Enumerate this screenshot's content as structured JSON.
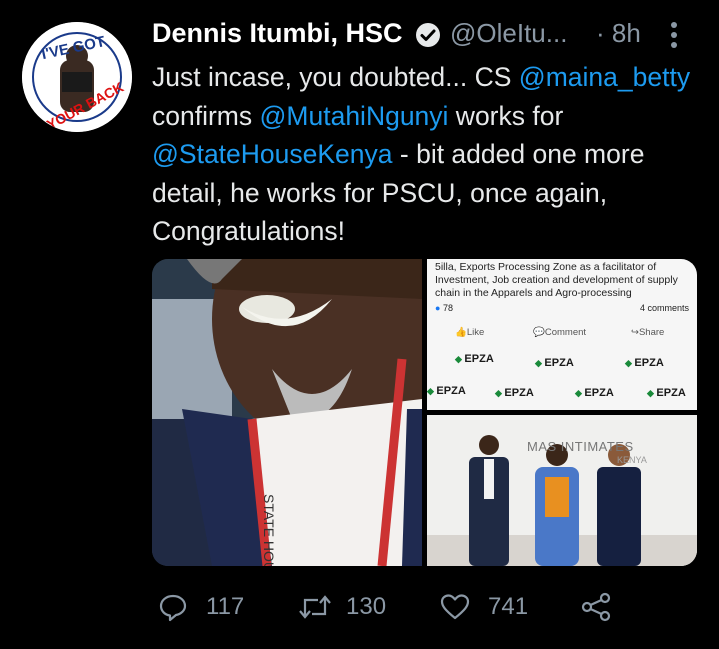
{
  "tweet": {
    "author_name": "Dennis Itumbi, HSC",
    "handle": "@OleItu...",
    "time_sep": "·",
    "time": "8h",
    "avatar_text_top": "I'VE GOT",
    "avatar_text_bottom": "YOUR BACK",
    "text": {
      "p1": "Just incase, you doubted... CS ",
      "m1": "@maina_betty",
      "p2": " confirms ",
      "m2": "@MutahiNgunyi",
      "p3": " works for ",
      "m3": "@StateHouseKenya",
      "p4": " - bit added one more detail, he works for PSCU, once again, Congratulations!"
    }
  },
  "media": {
    "top_right": {
      "text": "5illa, Exports Processing Zone as a facilitator of Investment, Job creation and development of supply chain in the Apparels and Agro-processing",
      "reactions": "78",
      "comments": "4 comments",
      "like": "Like",
      "comment": "Comment",
      "share": "Share",
      "epza": "EPZA"
    },
    "bottom_right": {
      "brand": "MAS INTIMATES",
      "brand_sub": "KENYA"
    },
    "left": {
      "lanyard_text": "STATE HOUSE"
    }
  },
  "actions": {
    "reply_count": "117",
    "retweet_count": "130",
    "like_count": "741"
  },
  "colors": {
    "background": "#000000",
    "text": "#e7e9ea",
    "secondary": "#8b98a5",
    "link": "#1d9bf0"
  },
  "icons": [
    "verified-icon",
    "more-icon",
    "reply-icon",
    "retweet-icon",
    "like-icon",
    "share-icon"
  ]
}
